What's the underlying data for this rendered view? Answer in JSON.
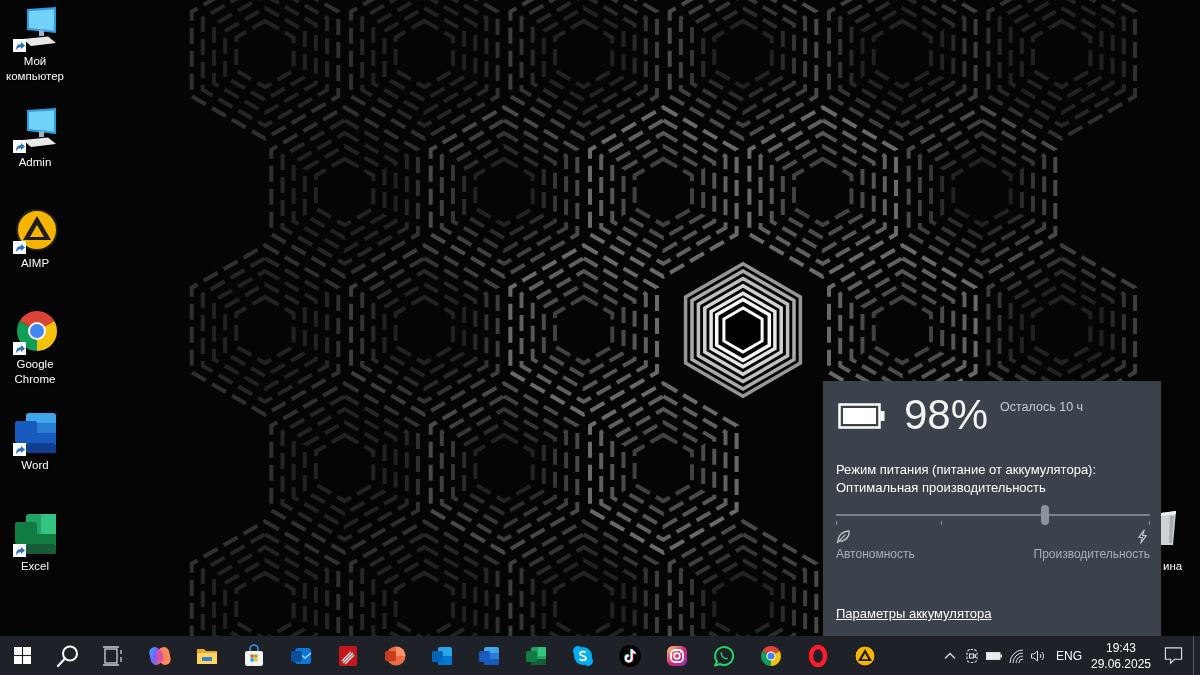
{
  "desktop": {
    "icons": [
      {
        "label": "Мой компьютер",
        "kind": "computer"
      },
      {
        "label": "Admin",
        "kind": "computer"
      },
      {
        "label": "AIMP",
        "kind": "aimp"
      },
      {
        "label": "Google Chrome",
        "kind": "chrome"
      },
      {
        "label": "Word",
        "kind": "word"
      },
      {
        "label": "Excel",
        "kind": "excel"
      }
    ],
    "partly_hidden_icon": {
      "label": "ина",
      "kind": "bin"
    }
  },
  "battery_flyout": {
    "charge": "98%",
    "time_left": "Осталось 10 ч",
    "mode_title": "Режим питания (питание от аккумулятора):",
    "mode_value": "Оптимальная производительность",
    "power_slider": {
      "level": 0.667
    },
    "left_label": "Автономность",
    "right_label": "Производительность",
    "settings_link": "Параметры аккумулятора"
  },
  "tray": {
    "language": "ENG",
    "time": "19:43",
    "date": "29.06.2025"
  }
}
